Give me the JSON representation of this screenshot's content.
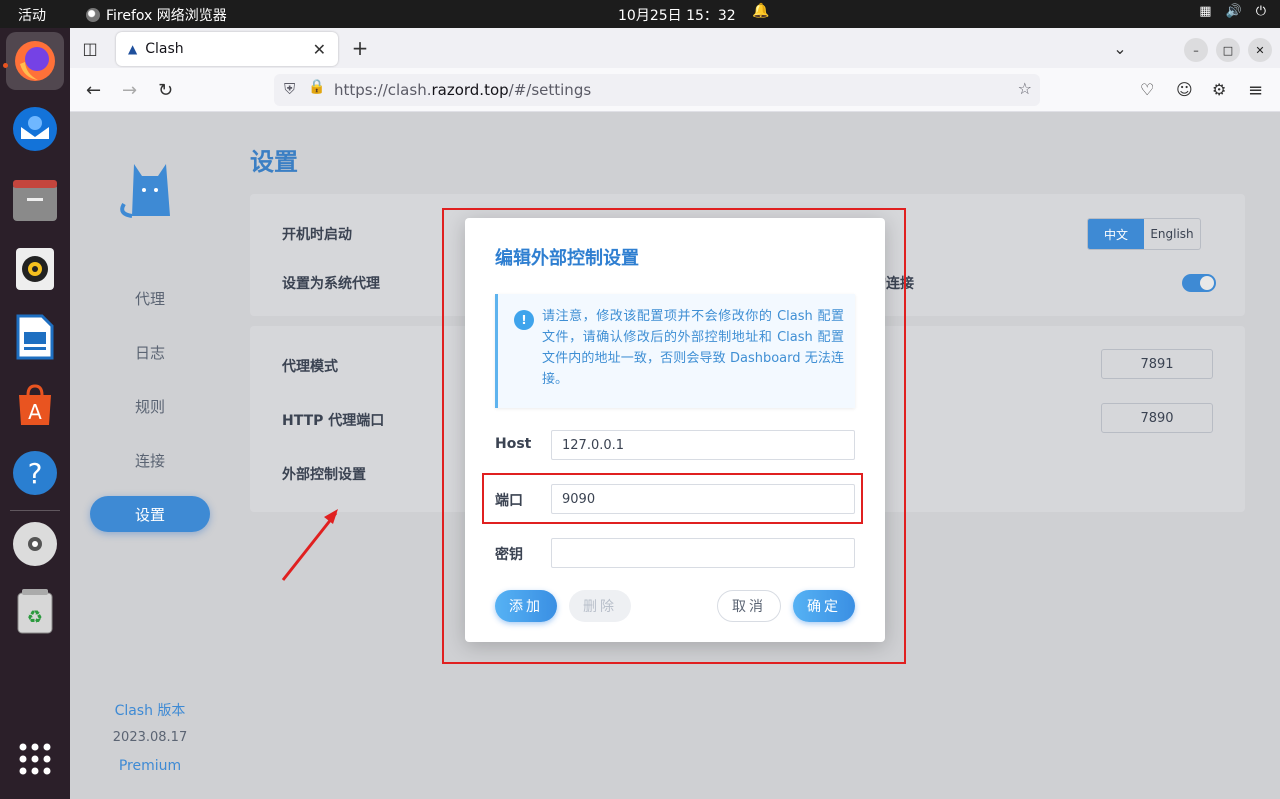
{
  "topbar": {
    "activities": "活动",
    "app_name": "Firefox 网络浏览器",
    "clock": "10月25日  15：32"
  },
  "browser": {
    "tab_title": "Clash",
    "url_prefix": "https://clash.",
    "url_domain": "razord.top",
    "url_suffix": "/#/settings"
  },
  "sidebar": {
    "items": [
      {
        "label": "代理"
      },
      {
        "label": "日志"
      },
      {
        "label": "规则"
      },
      {
        "label": "连接"
      },
      {
        "label": "设置"
      }
    ],
    "footer_title": "Clash 版本",
    "footer_version": "2023.08.17",
    "footer_edition": "Premium"
  },
  "settings": {
    "title": "设置",
    "startup_label": "开机时启动",
    "system_proxy_label": "设置为系统代理",
    "lang_zh": "中文",
    "lang_en": "English",
    "partial_conn_label": "的连接",
    "proxy_mode_label": "代理模式",
    "http_port_label": "HTTP 代理端口",
    "external_control_label": "外部控制设置",
    "right_value_1": "7891",
    "right_value_2": "7890"
  },
  "dialog": {
    "title": "编辑外部控制设置",
    "notice": "请注意，修改该配置项并不会修改你的 Clash 配置文件，请确认修改后的外部控制地址和 Clash 配置文件内的地址一致，否则会导致 Dashboard 无法连接。",
    "host_label": "Host",
    "host_value": "127.0.0.1",
    "port_label": "端口",
    "port_value": "9090",
    "secret_label": "密钥",
    "secret_value": "",
    "add_button": "添加",
    "delete_button": "删除",
    "cancel_button": "取消",
    "confirm_button": "确定"
  },
  "colors": {
    "accent": "#3e8ad4",
    "annotation": "#e02020"
  }
}
